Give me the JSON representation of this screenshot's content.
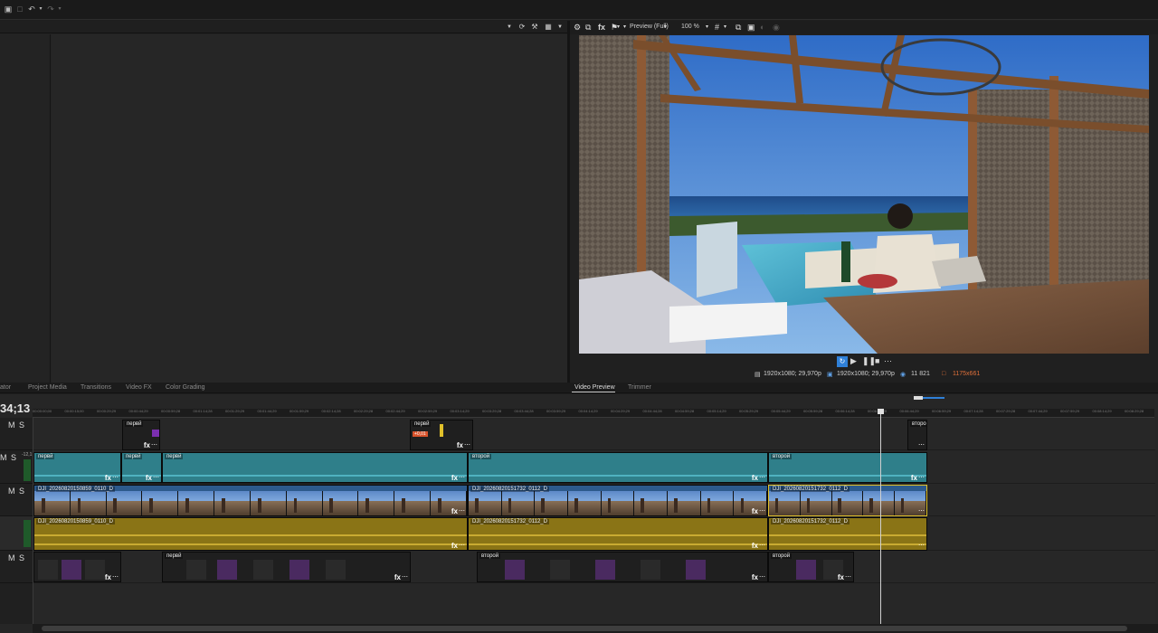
{
  "topbar": {
    "icons": [
      "save-icon",
      "delete-icon",
      "undo-icon",
      "redo-icon"
    ]
  },
  "left_panel": {
    "toolbar_icons": [
      "refresh-icon",
      "tools-icon",
      "view-icon",
      "menu-icon"
    ]
  },
  "preview": {
    "toolbar": {
      "quality": "Preview (Full)",
      "zoom": "100 %"
    },
    "info": {
      "project_format": "1920x1080; 29,970p",
      "preview_format": "1920x1080; 29,970p",
      "frame": "11 821",
      "display_size": "1175x661"
    },
    "accent_color": "#2f80d8"
  },
  "tabs": {
    "left": [
      "ator",
      "Project Media",
      "Transitions",
      "Video FX",
      "Color Grading"
    ],
    "right": [
      "Video Preview",
      "Trimmer"
    ],
    "active": "Video Preview"
  },
  "timeline": {
    "timecode": "34;13",
    "ruler": [
      "00:00:00;00",
      "00:00:15;00",
      "00:00:29;29",
      "00:00:44;29",
      "00:00:59;28",
      "00:01:14;28",
      "00:01:29;29",
      "00:01:44;29",
      "00:01:59;29",
      "00:02:14;28",
      "00:02:29;28",
      "00:02:44;29",
      "00:02:59;29",
      "00:03:14;29",
      "00:03:29;28",
      "00:03:44;28",
      "00:03:59;29",
      "00:04:14;29",
      "00:04:29;29",
      "00:04:44;28",
      "00:04:59;28",
      "00:05:14;29",
      "00:05:29;29",
      "00:05:44;29",
      "00:05:59;28",
      "00:06:14;28",
      "00:06:29;29",
      "00:06:44;29",
      "00:06:59;29",
      "00:07:14;28",
      "00:07:29;28",
      "00:07:44;29",
      "00:07:59;29",
      "00:08:14;29",
      "00:08:29;28"
    ],
    "tracks": [
      {
        "m": "M",
        "s": "S",
        "level": ""
      },
      {
        "m": "M",
        "s": "S",
        "level": "-12,1"
      },
      {
        "m": "M",
        "s": "S",
        "level": ""
      },
      {
        "m": "",
        "s": "",
        "level": ""
      },
      {
        "m": "M",
        "s": "S",
        "level": ""
      }
    ],
    "clip_labels": {
      "first": "первй",
      "second": "второй",
      "video_1": "DJI_20260820150859_0110_D",
      "video_2": "DJI_20260820151732_0112_D",
      "video_3": "DJI_20260820151732_0112_D",
      "fx": "fx",
      "more": "⋯",
      "badge": "+0,01"
    }
  }
}
